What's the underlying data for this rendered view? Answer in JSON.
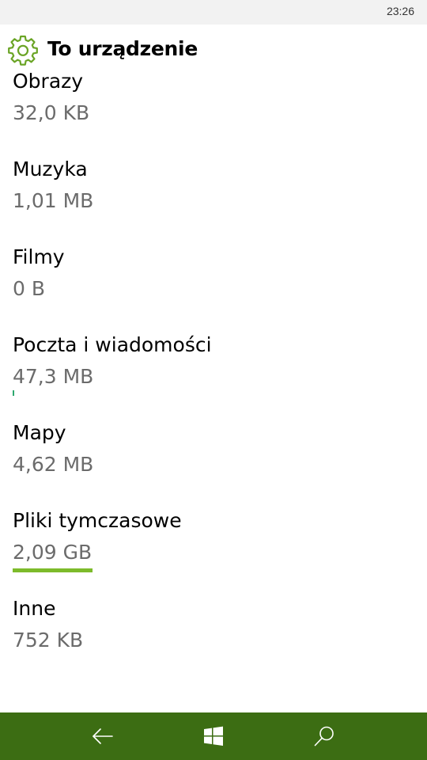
{
  "status": {
    "time": "23:26"
  },
  "header": {
    "title": "To urządzenie",
    "icon": "gear-icon",
    "accent": "#6aa425"
  },
  "items": [
    {
      "name": "Obrazy",
      "size": "32,0 KB",
      "usage": 0
    },
    {
      "name": "Muzyka",
      "size": "1,01 MB",
      "usage": 0
    },
    {
      "name": "Filmy",
      "size": "0 B",
      "usage": 0
    },
    {
      "name": "Poczta i wiadomości",
      "size": "47,3 MB",
      "usage": 0.02
    },
    {
      "name": "Mapy",
      "size": "4,62 MB",
      "usage": 0
    },
    {
      "name": "Pliki tymczasowe",
      "size": "2,09 GB",
      "usage": 1
    },
    {
      "name": "Inne",
      "size": "752 KB",
      "usage": 0
    }
  ],
  "navbar": {
    "color": "#3c6d13",
    "buttons": [
      "back-arrow-icon",
      "windows-start-icon",
      "search-icon"
    ]
  }
}
